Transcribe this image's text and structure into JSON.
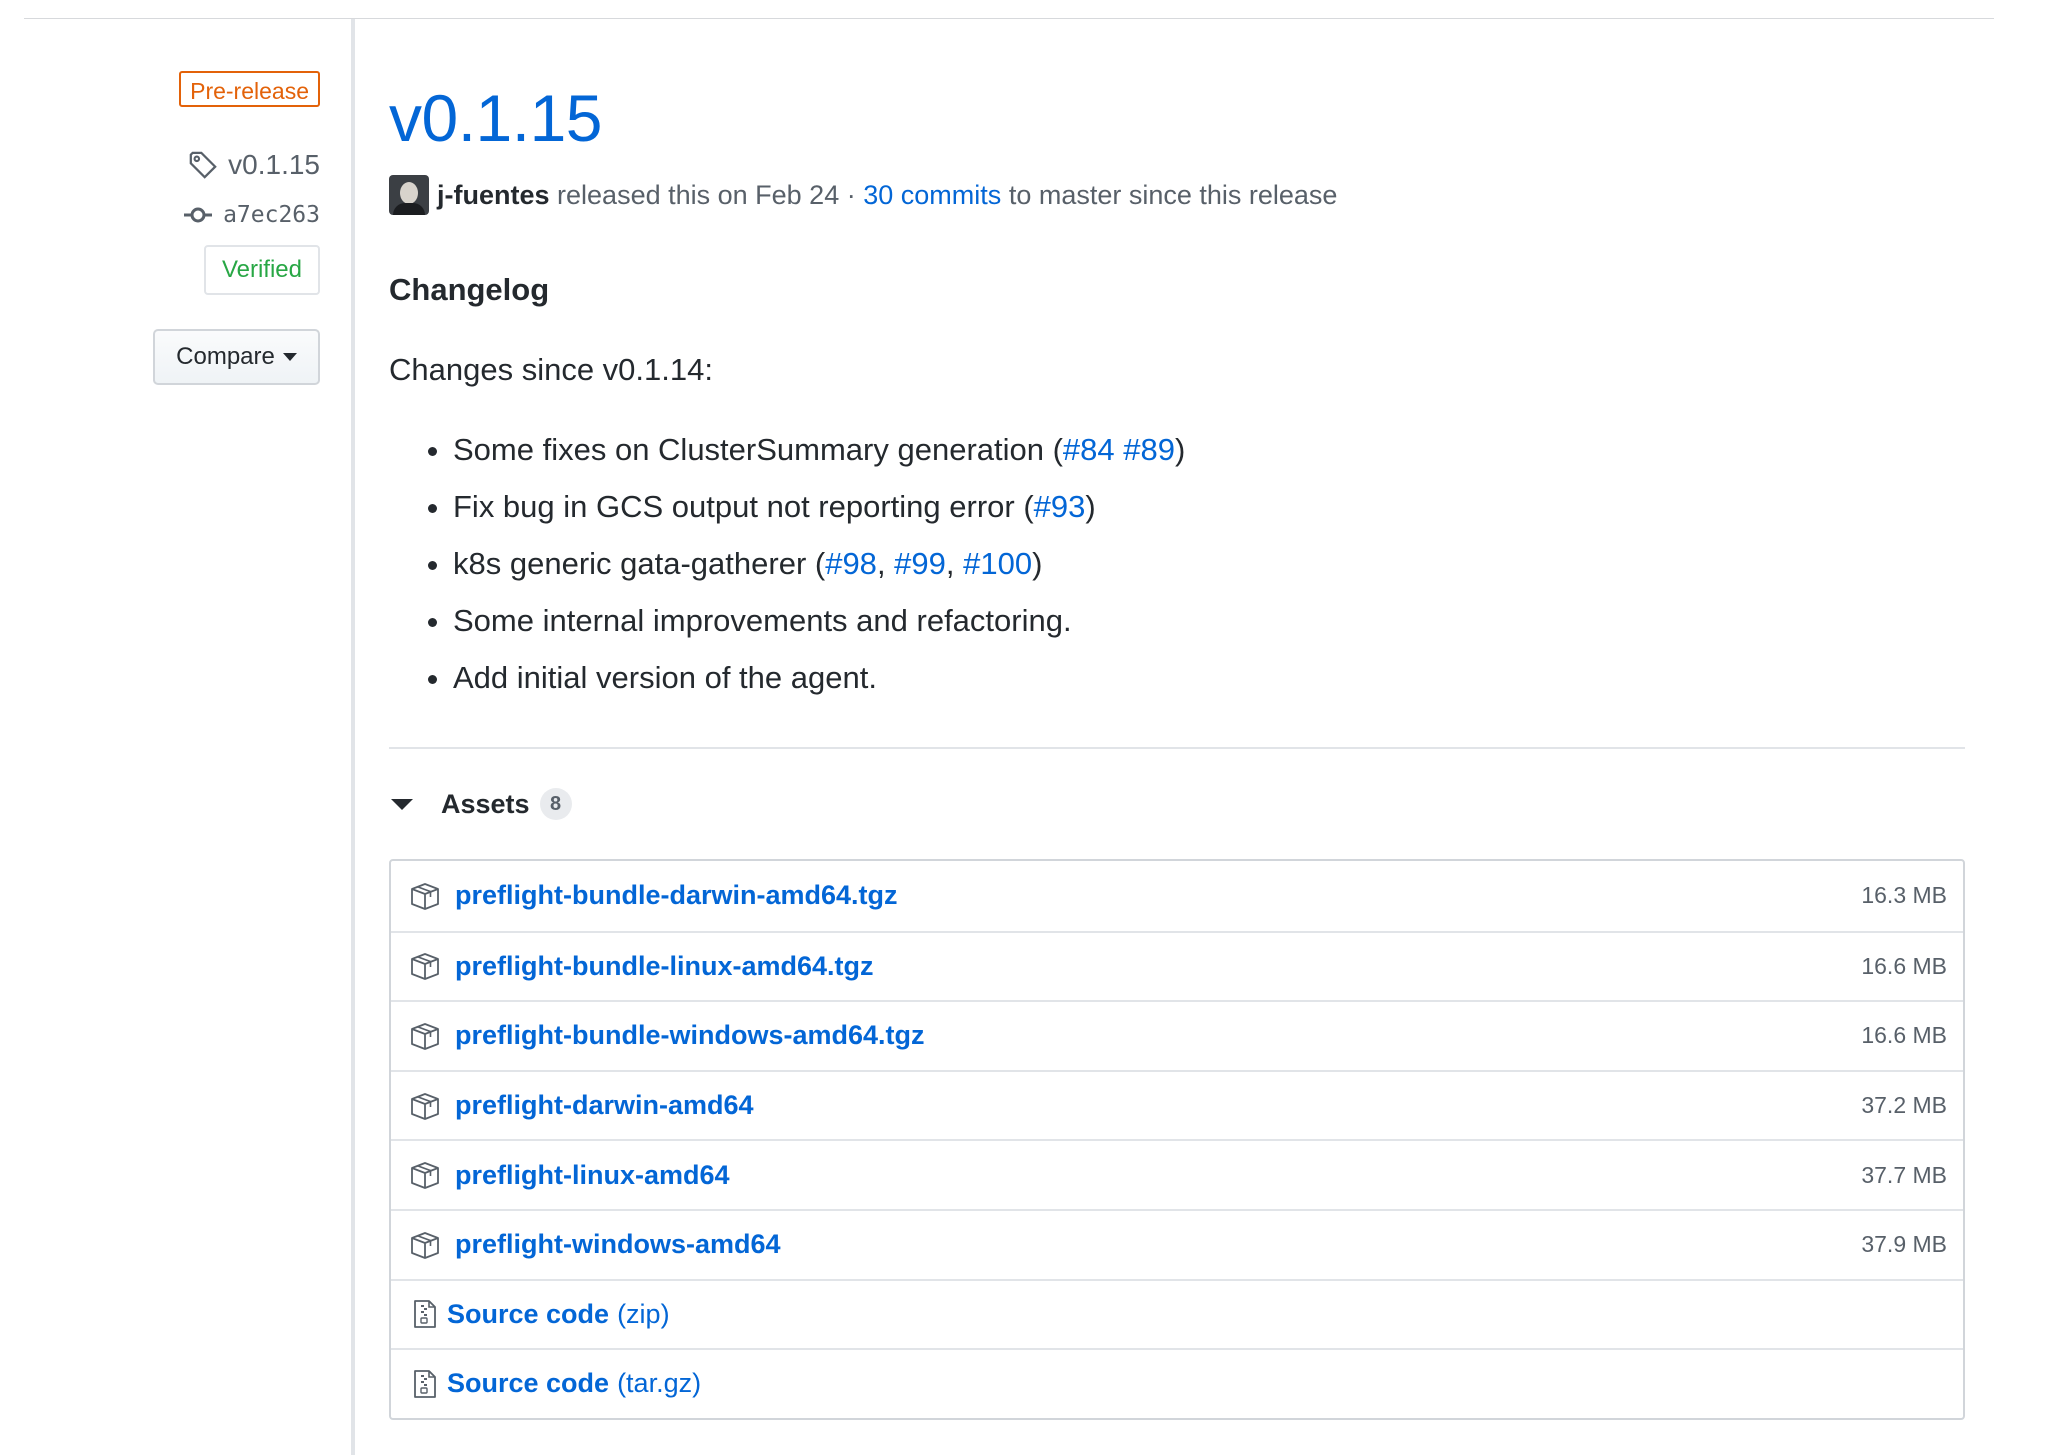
{
  "sidebar": {
    "prerelease_label": "Pre-release",
    "tag": "v0.1.15",
    "commit": "a7ec263",
    "verified_label": "Verified",
    "compare_label": "Compare"
  },
  "release": {
    "title": "v0.1.15",
    "author": "j-fuentes",
    "released_text": "released this on Feb 24",
    "separator": "·",
    "commits_link": "30 commits",
    "commits_suffix": "to master since this release"
  },
  "notes": {
    "heading": "Changelog",
    "intro": "Changes since v0.1.14:",
    "items": [
      {
        "text": "Some fixes on ClusterSummary generation (",
        "links": [
          "#84",
          "#89"
        ],
        "seps": [
          " "
        ],
        "end": ")"
      },
      {
        "text": "Fix bug in GCS output not reporting error (",
        "links": [
          "#93"
        ],
        "seps": [],
        "end": ")"
      },
      {
        "text": "k8s generic gata-gatherer (",
        "links": [
          "#98",
          "#99",
          "#100"
        ],
        "seps": [
          ", ",
          ", "
        ],
        "end": ")"
      },
      {
        "text": "Some internal improvements and refactoring.",
        "links": [],
        "seps": [],
        "end": ""
      },
      {
        "text": "Add initial version of the agent.",
        "links": [],
        "seps": [],
        "end": ""
      }
    ]
  },
  "assets": {
    "label": "Assets",
    "count": "8",
    "files": [
      {
        "name": "preflight-bundle-darwin-amd64.tgz",
        "size": "16.3 MB",
        "icon": "package-icon"
      },
      {
        "name": "preflight-bundle-linux-amd64.tgz",
        "size": "16.6 MB",
        "icon": "package-icon"
      },
      {
        "name": "preflight-bundle-windows-amd64.tgz",
        "size": "16.6 MB",
        "icon": "package-icon"
      },
      {
        "name": "preflight-darwin-amd64",
        "size": "37.2 MB",
        "icon": "package-icon"
      },
      {
        "name": "preflight-linux-amd64",
        "size": "37.7 MB",
        "icon": "package-icon"
      },
      {
        "name": "preflight-windows-amd64",
        "size": "37.9 MB",
        "icon": "package-icon"
      }
    ],
    "source": [
      {
        "name": "Source code",
        "ext": "(zip)",
        "icon": "file-zip-icon"
      },
      {
        "name": "Source code",
        "ext": "(tar.gz)",
        "icon": "file-zip-icon"
      }
    ]
  }
}
